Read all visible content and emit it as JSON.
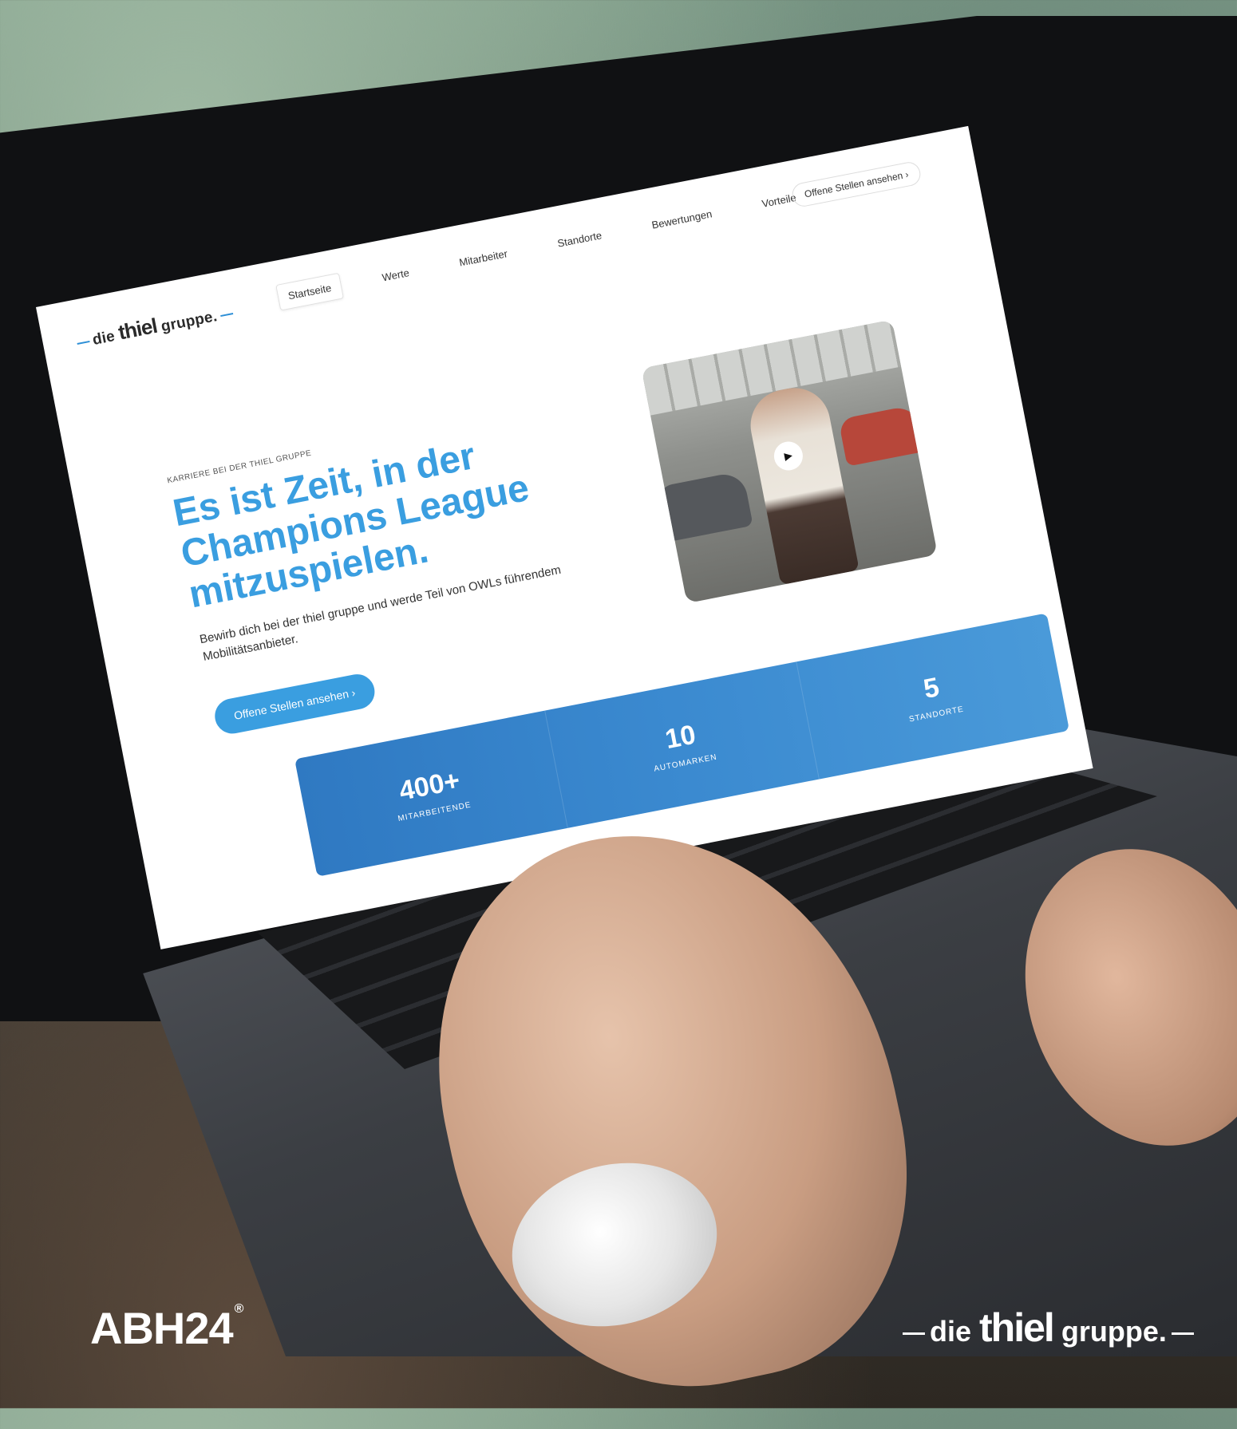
{
  "site": {
    "logo": {
      "prefix": "die",
      "brand": "thiel",
      "suffix": "gruppe."
    },
    "nav": {
      "items": [
        {
          "label": "Startseite",
          "active": true
        },
        {
          "label": "Werte"
        },
        {
          "label": "Mitarbeiter"
        },
        {
          "label": "Standorte"
        },
        {
          "label": "Bewertungen"
        },
        {
          "label": "Vorteile"
        }
      ],
      "cta_label": "Offene Stellen ansehen",
      "cta_icon": "chevron-right-icon"
    },
    "hero": {
      "kicker": "KARRIERE BEI DER THIEL GRUPPE",
      "headline": "Es ist Zeit, in der Champions League mitzuspielen.",
      "subtext": "Bewirb dich bei der thiel gruppe und werde Teil von OWLs führendem Mobilitätsanbieter.",
      "cta_label": "Offene Stellen ansehen",
      "cta_icon": "chevron-right-icon",
      "video_play_icon": "play-icon"
    },
    "stats": [
      {
        "value": "400+",
        "label": "MITARBEITENDE"
      },
      {
        "value": "10",
        "label": "AUTOMARKEN"
      },
      {
        "value": "5",
        "label": "STANDORTE"
      }
    ],
    "colors": {
      "accent": "#3a9ee0",
      "stats_bg_start": "#2f79c2",
      "stats_bg_end": "#4a9ad9"
    }
  },
  "overlay": {
    "abh_logo": "ABH24",
    "abh_mark": "®",
    "thiel_logo": {
      "prefix": "die",
      "brand": "thiel",
      "suffix": "gruppe."
    }
  }
}
